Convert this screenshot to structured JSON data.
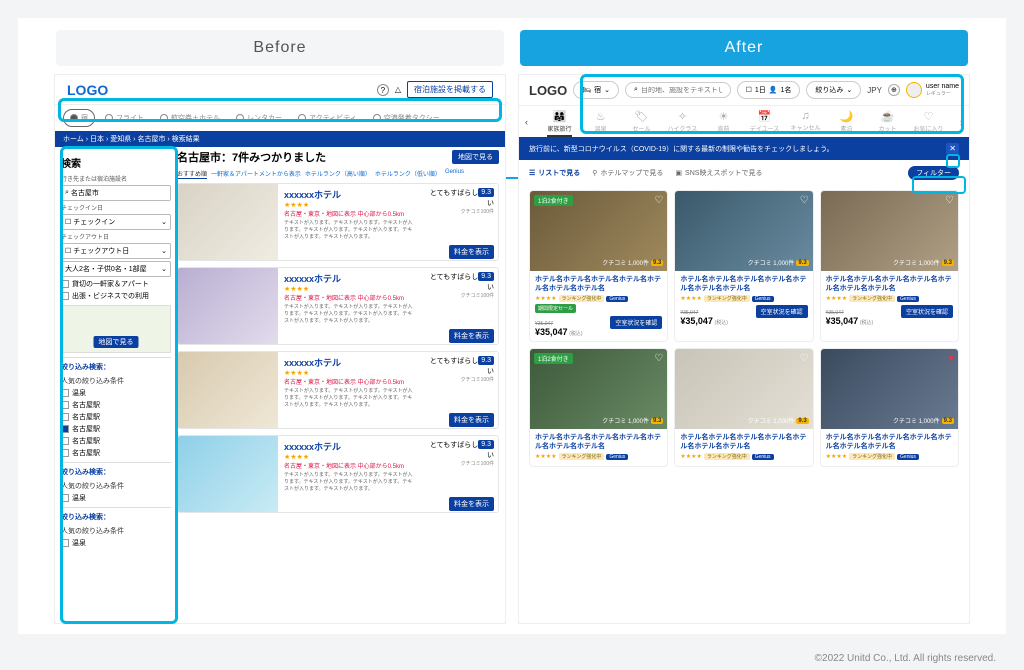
{
  "headings": {
    "before": "Before",
    "after": "After"
  },
  "footer": "©2022 Unitd Co., Ltd. All rights reserved.",
  "before": {
    "logo": "LOGO",
    "help_icon": "?",
    "bell_icon": "△",
    "header_btn": "宿泊施設を掲載する",
    "tabs": [
      "宿",
      "フライト",
      "航空券＋ホテル",
      "レンタカー",
      "アクティビティ",
      "空港発着タクシー"
    ],
    "breadcrumb": "ホーム › 日本 › 愛知県 › 名古屋市 › 検索結果",
    "search_heading": "検索",
    "dest_label": "行き先または宿泊施設名",
    "dest_value": "名古屋市",
    "checkin_label": "チェックイン日",
    "checkin_value": "チェックイン",
    "checkout_label": "チェックアウト日",
    "checkout_value": "チェックアウト日",
    "guests": "大人2名・子供0名・1部屋",
    "trip_checks": [
      "貸切の一軒家＆アパート",
      "出張・ビジネスでの利用"
    ],
    "map_btn": "地図で見る",
    "filter_h1": "絞り込み検索：",
    "filter_h2": "人気の絞り込み条件",
    "filters": [
      "温泉",
      "名古屋駅",
      "名古屋駅",
      "名古屋駅",
      "名古屋駅",
      "名古屋駅"
    ],
    "filter_checked_index": 3,
    "filter_more": "絞り込み検索：",
    "results_title": "名古屋市：7件みつかりました",
    "results_map_btn": "地図で見る",
    "sort": [
      "おすすめ順",
      "一軒家＆アパートメントから表示",
      "ホテルランク（高い順）",
      "ホテルランク（低い順）",
      "Genius"
    ],
    "card_title": "xxxxxxホテル",
    "card_meta": "名古屋・東京・地図に表示 中心部から0.5km",
    "card_desc": "テキストが入ります。テキストが入ります。テキストが入ります。テキストが入ります。テキストが入ります。テキストが入ります。テキストが入ります。",
    "rating_label": "とてもすばらしい",
    "rating_score": "9.3",
    "review_count": "クチコミ100件",
    "price_btn": "料金を表示"
  },
  "after": {
    "logo": "LOGO",
    "category_pill": "宿",
    "search_placeholder": "目的地、施設をテキストしてくだ",
    "date": "1日",
    "guests": "1名",
    "refine": "絞り込み",
    "currency": "JPY",
    "user_name": "user name",
    "user_sub": "レギュラー",
    "cats": [
      {
        "icon": "👨‍👩‍👧",
        "label": "家族旅行",
        "on": true
      },
      {
        "icon": "♨",
        "label": "温泉"
      },
      {
        "icon": "🏷",
        "label": "セール"
      },
      {
        "icon": "✧",
        "label": "ハイクラス"
      },
      {
        "icon": "☀",
        "label": "直前"
      },
      {
        "icon": "📅",
        "label": "デイユース"
      },
      {
        "icon": "♫",
        "label": "キャンセル"
      },
      {
        "icon": "🌙",
        "label": "素泊"
      },
      {
        "icon": "☕",
        "label": "カット"
      },
      {
        "icon": "♡",
        "label": "お気に入り"
      }
    ],
    "banner": "旅行前に、新型コロナウイルス（COVID-19）に関する最新の制限や勧告をチェックしましょう。",
    "banner_x": "✕",
    "view_tabs": [
      "リストで見る",
      "ホテルマップで見る",
      "SNS映えスポットで見る"
    ],
    "filter_pill": "フィルター",
    "c": {
      "name": "ホテル名ホテル名ホテル名ホテル名ホテル名ホテル名ホテル名",
      "stars": "★★★★",
      "tag1": "ランキング強化中",
      "tag2": "Genius",
      "deal": "期間限定セール",
      "review": "クチコミ 1,000件",
      "score": "9.3",
      "strike": "¥35,047",
      "price": "¥35,047",
      "tax": "(税込)",
      "avail": "空室状況を確認",
      "badge": "1泊2食付き"
    }
  }
}
